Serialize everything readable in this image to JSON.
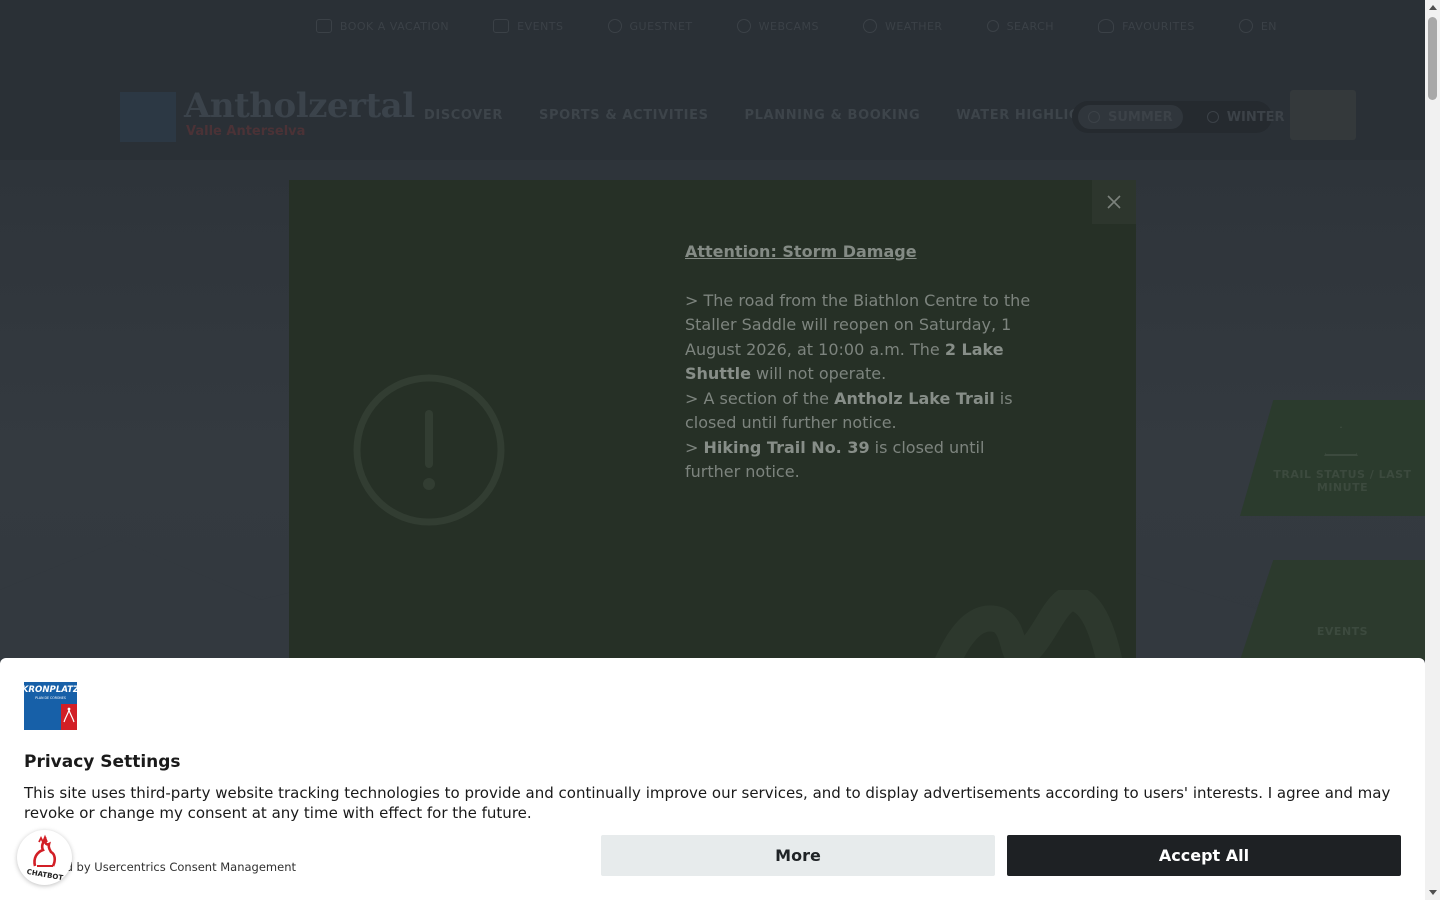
{
  "topbar": {
    "items": [
      {
        "label": "BOOK A VACATION",
        "icon": "calendar-icon"
      },
      {
        "label": "EVENTS",
        "icon": "megaphone-icon"
      },
      {
        "label": "GUESTNET",
        "icon": "info-icon"
      },
      {
        "label": "WEBCAMS",
        "icon": "webcam-icon"
      },
      {
        "label": "WEATHER",
        "icon": "weather-icon"
      },
      {
        "label": "SEARCH",
        "icon": "search-icon"
      },
      {
        "label": "FAVOURITES",
        "icon": "heart-icon"
      },
      {
        "label": "EN",
        "icon": "globe-icon"
      }
    ]
  },
  "brand": {
    "name": "Antholzertal",
    "subtitle": "Valle Anterselva"
  },
  "mainnav": {
    "items": [
      "DISCOVER",
      "SPORTS & ACTIVITIES",
      "PLANNING & BOOKING",
      "WATER HIGHLIGHTS"
    ]
  },
  "season": {
    "summer": "SUMMER",
    "winter": "WINTER"
  },
  "side_tiles": {
    "tile1": "TRAIL STATUS / LAST MINUTE",
    "tile2": "EVENTS"
  },
  "modal": {
    "title": "Attention: Storm Damage",
    "line1_a": "> The road from the Biathlon Centre to the Staller Saddle will reopen on Saturday, 1 August 2026, at 10:00 a.m. The ",
    "line1_b": "2 Lake Shuttle",
    "line1_c": " will not operate.",
    "line2_a": "> A section of the ",
    "line2_b": "Antholz Lake Trail",
    "line2_c": " is closed until further notice.",
    "line3_a": "> ",
    "line3_b": "Hiking Trail No. 39",
    "line3_c": " is closed until further notice."
  },
  "consent": {
    "logo_text": "KRONPLATZ",
    "logo_sub": "PLAN DE CORONES",
    "title": "Privacy Settings",
    "description": "This site uses third-party website tracking technologies to provide and continually improve our services, and to display advertisements according to users' interests. I agree and may revoke or change my consent at any time with effect for the future.",
    "powered_by": "Powered by Usercentrics Consent Management",
    "more_label": "More",
    "accept_label": "Accept All"
  },
  "chatbot": {
    "label": "CHATBOT"
  },
  "colors": {
    "modal_bg": "#263026",
    "accept_bg": "#1e2124",
    "more_bg": "#e7ebec",
    "brand_red": "#d21f26",
    "brand_blue": "#1760a8"
  }
}
